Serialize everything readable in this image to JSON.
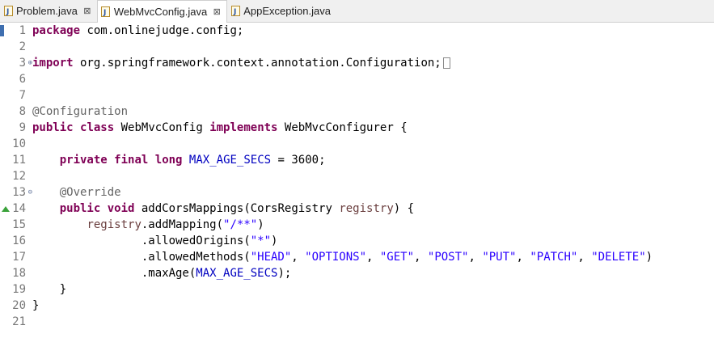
{
  "tabs": [
    {
      "label": "Problem.java",
      "close": "⊠",
      "active": false
    },
    {
      "label": "WebMvcConfig.java",
      "close": "⊠",
      "active": true
    },
    {
      "label": "AppException.java",
      "close": "",
      "active": false
    }
  ],
  "colors": {
    "keyword": "#7f0055",
    "annotation": "#646464",
    "field": "#0000c0",
    "string": "#2a00ff",
    "parameter": "#6a3e3e",
    "line_number": "#787878"
  },
  "lines": [
    {
      "n": "1",
      "tokens": [
        [
          "kw",
          "package"
        ],
        [
          "t",
          " com.onlinejudge.config;"
        ]
      ]
    },
    {
      "n": "2",
      "tokens": []
    },
    {
      "n": "3",
      "fold": "⊕",
      "folded": true,
      "tokens": [
        [
          "kw",
          "import"
        ],
        [
          "t",
          " org.springframework.context.annotation.Configuration;"
        ]
      ]
    },
    {
      "n": "6",
      "tokens": []
    },
    {
      "n": "7",
      "tokens": []
    },
    {
      "n": "8",
      "tokens": [
        [
          "ann",
          "@Configuration"
        ]
      ]
    },
    {
      "n": "9",
      "tokens": [
        [
          "kw",
          "public"
        ],
        [
          "t",
          " "
        ],
        [
          "kw",
          "class"
        ],
        [
          "t",
          " WebMvcConfig "
        ],
        [
          "kw",
          "implements"
        ],
        [
          "t",
          " WebMvcConfigurer {"
        ]
      ]
    },
    {
      "n": "10",
      "tokens": []
    },
    {
      "n": "11",
      "tokens": [
        [
          "t",
          "    "
        ],
        [
          "kw",
          "private"
        ],
        [
          "t",
          " "
        ],
        [
          "kw",
          "final"
        ],
        [
          "t",
          " "
        ],
        [
          "kw",
          "long"
        ],
        [
          "t",
          " "
        ],
        [
          "fld",
          "MAX_AGE_SECS"
        ],
        [
          "t",
          " = 3600;"
        ]
      ]
    },
    {
      "n": "12",
      "tokens": []
    },
    {
      "n": "13",
      "fold": "⊖",
      "tokens": [
        [
          "t",
          "    "
        ],
        [
          "ann",
          "@Override"
        ]
      ]
    },
    {
      "n": "14",
      "override": true,
      "tokens": [
        [
          "t",
          "    "
        ],
        [
          "kw",
          "public"
        ],
        [
          "t",
          " "
        ],
        [
          "kw",
          "void"
        ],
        [
          "t",
          " addCorsMappings(CorsRegistry "
        ],
        [
          "param",
          "registry"
        ],
        [
          "t",
          ") {"
        ]
      ]
    },
    {
      "n": "15",
      "tokens": [
        [
          "t",
          "        "
        ],
        [
          "param",
          "registry"
        ],
        [
          "t",
          ".addMapping("
        ],
        [
          "str",
          "\"/**\""
        ],
        [
          "t",
          ")"
        ]
      ]
    },
    {
      "n": "16",
      "tokens": [
        [
          "t",
          "                .allowedOrigins("
        ],
        [
          "str",
          "\"*\""
        ],
        [
          "t",
          ")"
        ]
      ]
    },
    {
      "n": "17",
      "tokens": [
        [
          "t",
          "                .allowedMethods("
        ],
        [
          "str",
          "\"HEAD\""
        ],
        [
          "t",
          ", "
        ],
        [
          "str",
          "\"OPTIONS\""
        ],
        [
          "t",
          ", "
        ],
        [
          "str",
          "\"GET\""
        ],
        [
          "t",
          ", "
        ],
        [
          "str",
          "\"POST\""
        ],
        [
          "t",
          ", "
        ],
        [
          "str",
          "\"PUT\""
        ],
        [
          "t",
          ", "
        ],
        [
          "str",
          "\"PATCH\""
        ],
        [
          "t",
          ", "
        ],
        [
          "str",
          "\"DELETE\""
        ],
        [
          "t",
          ")"
        ]
      ]
    },
    {
      "n": "18",
      "tokens": [
        [
          "t",
          "                .maxAge("
        ],
        [
          "fld",
          "MAX_AGE_SECS"
        ],
        [
          "t",
          ");"
        ]
      ]
    },
    {
      "n": "19",
      "tokens": [
        [
          "t",
          "    }"
        ]
      ]
    },
    {
      "n": "20",
      "tokens": [
        [
          "t",
          "}"
        ]
      ]
    },
    {
      "n": "21",
      "tokens": []
    }
  ]
}
